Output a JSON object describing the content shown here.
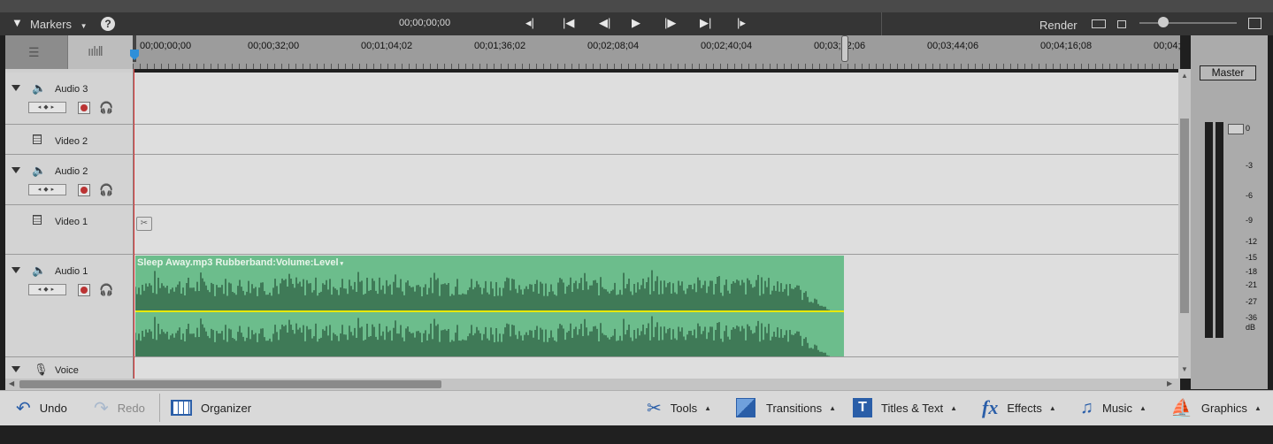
{
  "toolbar": {
    "markers_label": "Markers",
    "timecode": "00;00;00;00",
    "render_label": "Render",
    "help_icon": "?"
  },
  "ruler": {
    "labels": [
      "00;00;00;00",
      "00;00;32;00",
      "00;01;04;02",
      "00;01;36;02",
      "00;02;08;04",
      "00;02;40;04",
      "00;03;12;06",
      "00;03;44;06",
      "00;04;16;08",
      "00;04;"
    ]
  },
  "tracks": {
    "audio3": "Audio 3",
    "video2": "Video 2",
    "audio2": "Audio 2",
    "video1": "Video 1",
    "audio1": "Audio 1",
    "voice": "Voice"
  },
  "clip": {
    "title": "Sleep Away.mp3 Rubberband:Volume:Level"
  },
  "meter": {
    "master_label": "Master",
    "db_labels": [
      "0",
      "-3",
      "-6",
      "-9",
      "-12",
      "-15",
      "-18",
      "-21",
      "-27",
      "-36",
      "dB"
    ]
  },
  "bottom": {
    "undo": "Undo",
    "redo": "Redo",
    "organizer": "Organizer",
    "tools": "Tools",
    "transitions": "Transitions",
    "titles": "Titles & Text",
    "effects": "Effects",
    "music": "Music",
    "graphics": "Graphics"
  },
  "colors": {
    "clip_green": "#6cbd8c",
    "wave_dark": "#3f7a57",
    "rubberband": "#e8e800",
    "playhead": "#dd3333"
  }
}
